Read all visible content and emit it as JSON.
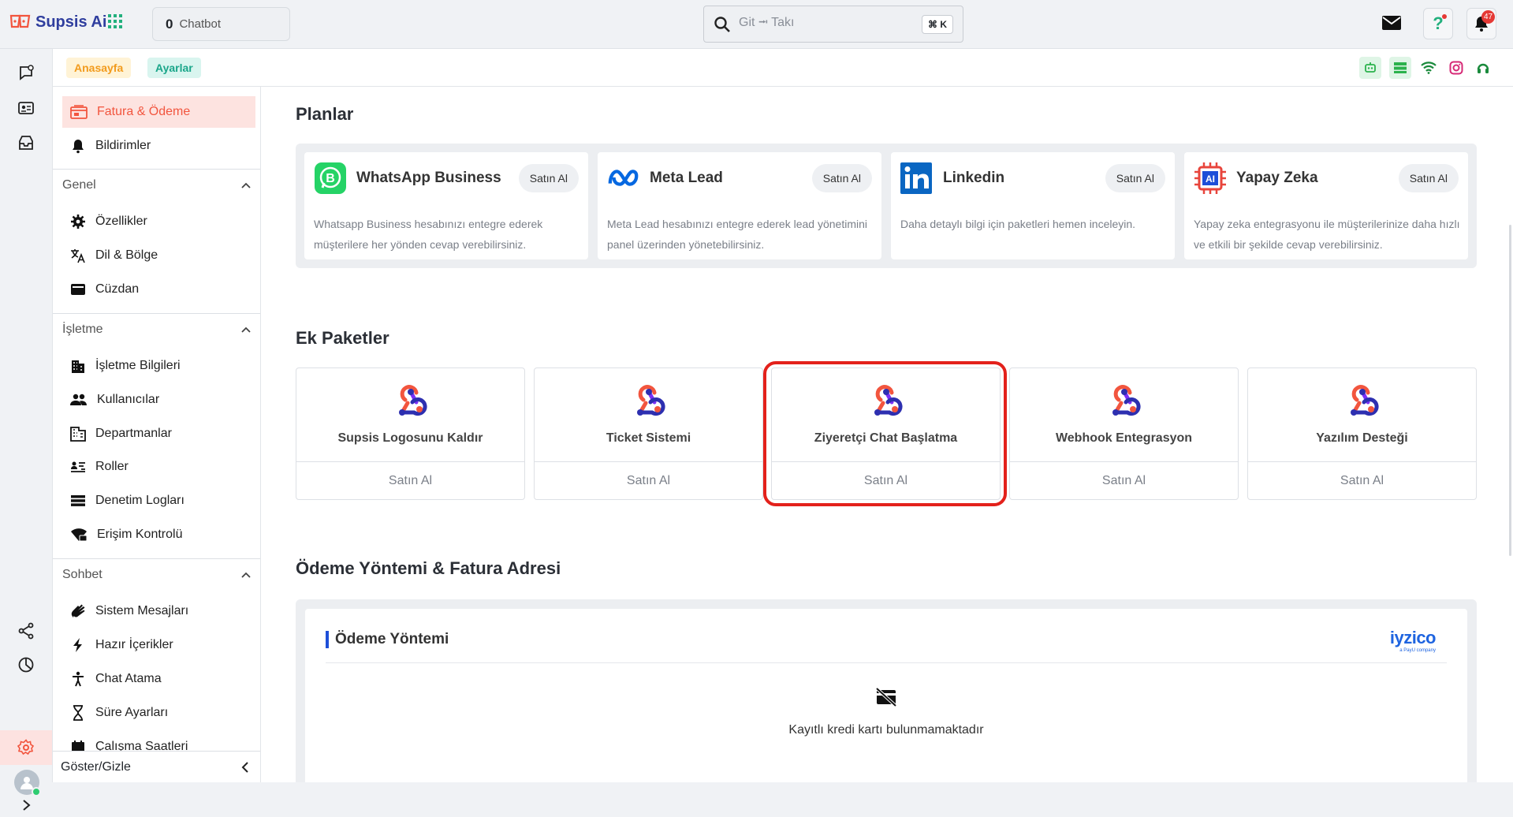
{
  "app": {
    "name": "Supsis Ai"
  },
  "topbar": {
    "chatbot_count": "0",
    "chatbot_label": "Chatbot",
    "search_placeholder": "Git ⭲ Takı",
    "search_shortcut": "⌘ K",
    "notification_count": "47"
  },
  "breadcrumb": {
    "items": [
      "Anasayfa",
      "Ayarlar"
    ]
  },
  "sidebar": {
    "top_items": [
      {
        "label": "Fatura & Ödeme",
        "icon": "billing-icon",
        "active": true
      },
      {
        "label": "Bildirimler",
        "icon": "bell-icon"
      }
    ],
    "sections": [
      {
        "title": "Genel",
        "items": [
          {
            "label": "Özellikler",
            "icon": "gear-icon"
          },
          {
            "label": "Dil & Bölge",
            "icon": "translate-icon"
          },
          {
            "label": "Cüzdan",
            "icon": "wallet-icon"
          }
        ]
      },
      {
        "title": "İşletme",
        "items": [
          {
            "label": "İşletme Bilgileri",
            "icon": "building-icon"
          },
          {
            "label": "Kullanıcılar",
            "icon": "users-icon"
          },
          {
            "label": "Departmanlar",
            "icon": "department-icon"
          },
          {
            "label": "Roller",
            "icon": "roles-icon"
          },
          {
            "label": "Denetim Logları",
            "icon": "logs-icon"
          },
          {
            "label": "Erişim Kontrolü",
            "icon": "access-icon"
          }
        ]
      },
      {
        "title": "Sohbet",
        "items": [
          {
            "label": "Sistem Mesajları",
            "icon": "hand-icon"
          },
          {
            "label": "Hazır İçerikler",
            "icon": "bolt-icon"
          },
          {
            "label": "Chat Atama",
            "icon": "person-icon"
          },
          {
            "label": "Süre Ayarları",
            "icon": "hourglass-icon"
          },
          {
            "label": "Çalışma Saatleri",
            "icon": "calendar-icon"
          }
        ]
      }
    ],
    "footer": "Göster/Gizle"
  },
  "plans": {
    "title": "Planlar",
    "items": [
      {
        "name": "WhatsApp Business",
        "button": "Satın Al",
        "description": "Whatsapp Business hesabınızı entegre ederek müşterilere her yönden cevap verebilirsiniz."
      },
      {
        "name": "Meta Lead",
        "button": "Satın Al",
        "description": "Meta Lead hesabınızı entegre ederek lead yönetimini panel üzerinden yönetebilirsiniz."
      },
      {
        "name": "Linkedin",
        "button": "Satın Al",
        "description": "Daha detaylı bilgi için paketleri hemen inceleyin."
      },
      {
        "name": "Yapay Zeka",
        "button": "Satın Al",
        "description": "Yapay zeka entegrasyonu ile müşterilerinize daha hızlı ve etkili bir şekilde cevap verebilirsiniz."
      }
    ]
  },
  "packages": {
    "title": "Ek Paketler",
    "items": [
      {
        "name": "Supsis Logosunu Kaldır",
        "button": "Satın Al"
      },
      {
        "name": "Ticket Sistemi",
        "button": "Satın Al"
      },
      {
        "name": "Ziyeretçi Chat Başlatma",
        "button": "Satın Al"
      },
      {
        "name": "Webhook Entegrasyon",
        "button": "Satın Al"
      },
      {
        "name": "Yazılım Desteği",
        "button": "Satın Al"
      }
    ]
  },
  "payment": {
    "section_title": "Ödeme Yöntemi & Fatura Adresi",
    "card_title": "Ödeme Yöntemi",
    "provider": "iyzico",
    "provider_tagline": "a PayU company",
    "empty_text": "Kayıtlı kredi kartı bulunmamaktadır"
  },
  "colors": {
    "accent": "#f2553e",
    "brand": "#2f3e9e",
    "highlight": "#e3211b"
  }
}
